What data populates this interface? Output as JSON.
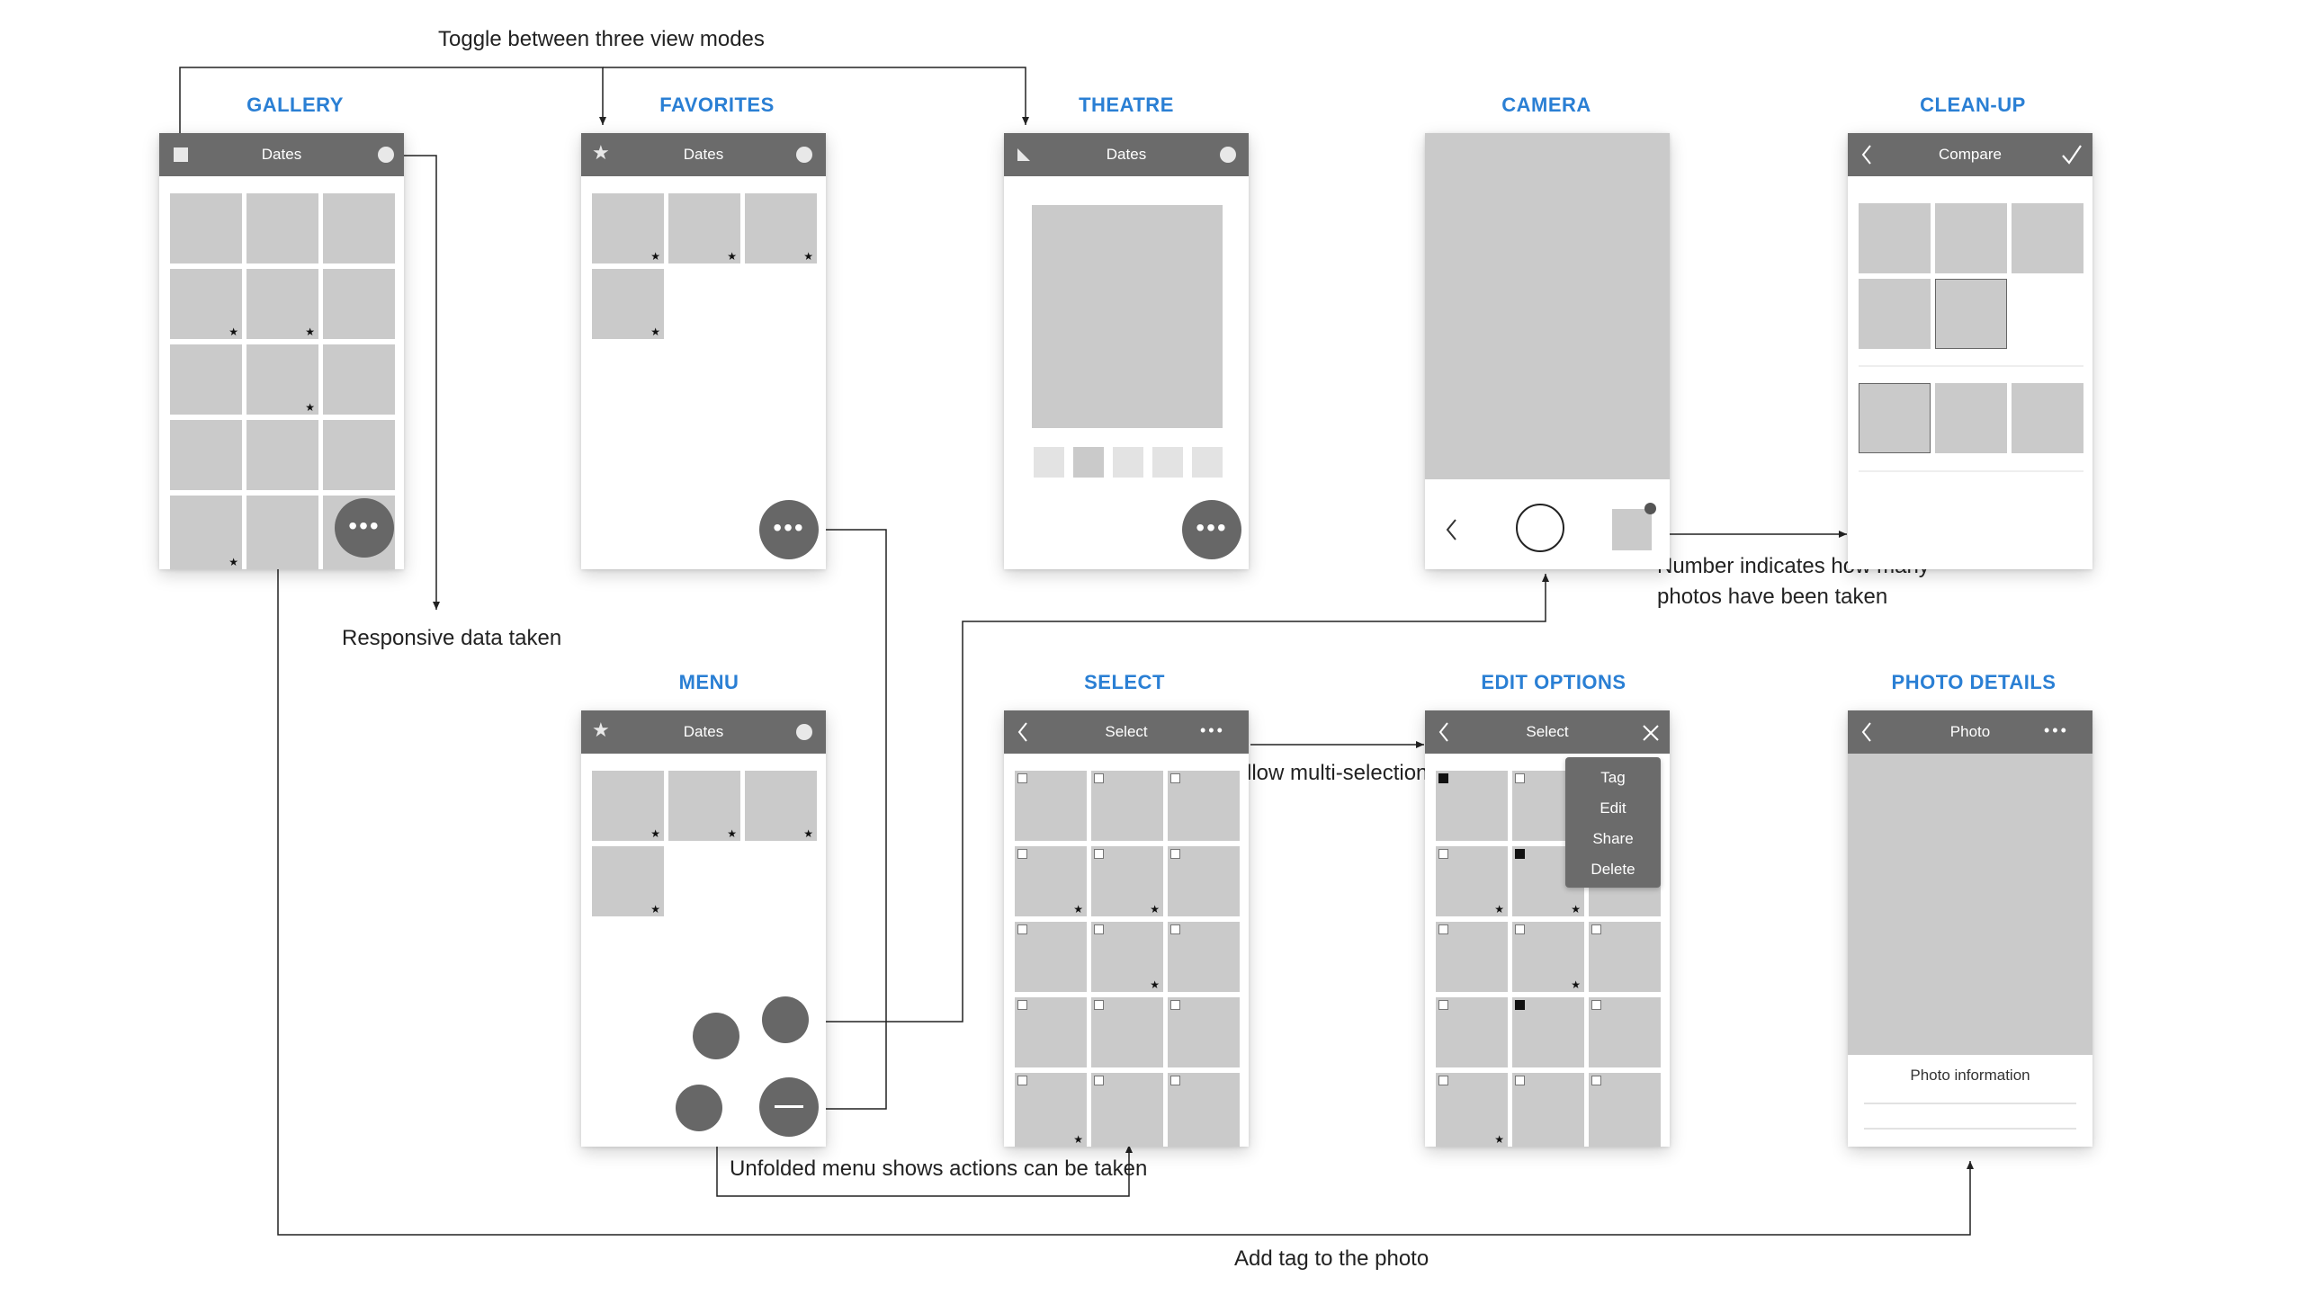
{
  "screens": {
    "gallery": {
      "title": "GALLERY",
      "bar": "Dates"
    },
    "favorites": {
      "title": "FAVORITES",
      "bar": "Dates"
    },
    "theatre": {
      "title": "THEATRE",
      "bar": "Dates"
    },
    "camera": {
      "title": "CAMERA"
    },
    "cleanup": {
      "title": "CLEAN-UP",
      "bar": "Compare"
    },
    "menu": {
      "title": "MENU",
      "bar": "Dates"
    },
    "select": {
      "title": "SELECT",
      "bar": "Select"
    },
    "edit": {
      "title": "EDIT OPTIONS",
      "bar": "Select",
      "menu_items": [
        "Tag",
        "Edit",
        "Share",
        "Delete"
      ]
    },
    "details": {
      "title": "PHOTO DETAILS",
      "bar": "Photo",
      "info": "Photo information"
    }
  },
  "more_glyph": "•••",
  "annotations": {
    "toggle": "Toggle between three view modes",
    "responsive": "Responsive data taken",
    "number_line1": "Number indicates how many",
    "number_line2": "photos have been taken",
    "multi": "Allow multi-selection",
    "unfolded": "Unfolded menu shows actions can be taken",
    "addtag": "Add tag to the photo"
  },
  "colors": {
    "title": "#2a7fd4",
    "bar": "#6b6b6b",
    "tile": "#cacaca",
    "fab": "#676767"
  }
}
